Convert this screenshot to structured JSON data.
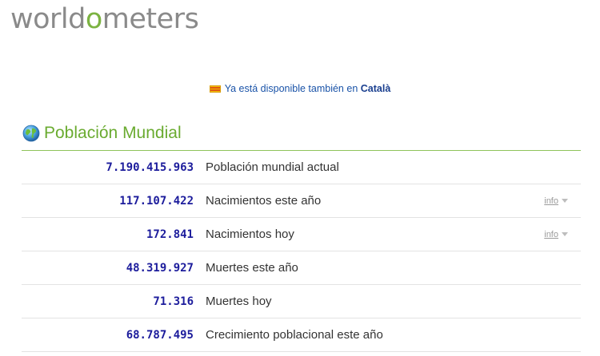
{
  "logo": {
    "part1": "world",
    "part2": "o",
    "part3": "meters"
  },
  "notice": {
    "text": "Ya está disponible también en",
    "link": "Català"
  },
  "section": {
    "title": "Población Mundial"
  },
  "stats": [
    {
      "value": "7.190.415.963",
      "label": "Población mundial actual",
      "info": ""
    },
    {
      "value": "117.107.422",
      "label": "Nacimientos este año",
      "info": "info"
    },
    {
      "value": "172.841",
      "label": "Nacimientos hoy",
      "info": "info"
    },
    {
      "value": "48.319.927",
      "label": "Muertes este año",
      "info": ""
    },
    {
      "value": "71.316",
      "label": "Muertes hoy",
      "info": ""
    },
    {
      "value": "68.787.495",
      "label": "Crecimiento poblacional este año",
      "info": ""
    }
  ],
  "colors": {
    "brand_green": "#7cb342",
    "number_blue": "#1c1c9c",
    "link_blue": "#1a53a8"
  },
  "icons": {
    "globe": "globe-icon",
    "flag": "catalan-flag-icon",
    "caret": "caret-down-icon"
  }
}
